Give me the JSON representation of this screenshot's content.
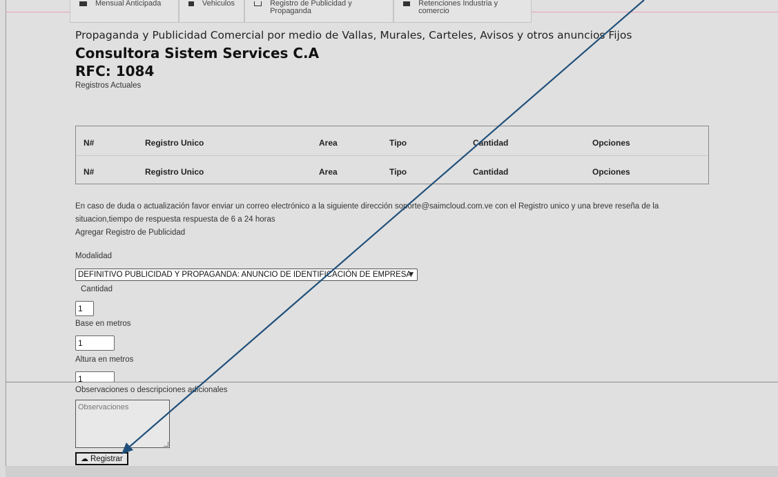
{
  "tabs": [
    {
      "icon": "calendar-icon",
      "label": "Mensual Anticipada"
    },
    {
      "icon": "car-icon",
      "label": "Vehiculos"
    },
    {
      "icon": "billboard-icon",
      "label": "Registro de Publicidad y Propaganda"
    },
    {
      "icon": "building-icon",
      "label": "Retenciones Industria y comercio"
    }
  ],
  "header": {
    "line_title": "Propaganda y Publicidad Comercial por medio de Vallas, Murales, Carteles, Avisos y otros anuncios Fijos",
    "company": "Consultora Sistem Services C.A",
    "rfc": "RFC: 1084",
    "subtitle": "Registros Actuales"
  },
  "table": {
    "columns": [
      "N#",
      "Registro Unico",
      "Area",
      "Tipo",
      "Cantidad",
      "Opciones"
    ],
    "footer_columns": [
      "N#",
      "Registro Unico",
      "Area",
      "Tipo",
      "Cantidad",
      "Opciones"
    ]
  },
  "info": {
    "line1": "En caso de duda o actualización favor enviar un correo electrónico a la siguiente dirección soporte@saimcloud.com.ve con el Registro unico y una breve reseña de la",
    "line2": "situacion,tiempo de respuesta respuesta de 6 a 24 horas",
    "add_title": "Agregar Registro de Publicidad"
  },
  "form": {
    "modalidad_label": "Modalidad",
    "modalidad_value": "DEFINITIVO PUBLICIDAD Y PROPAGANDA: ANUNCIO DE IDENTIFICACIÓN DE EMPRESA",
    "cantidad_label": "Cantidad",
    "cantidad_value": "1",
    "base_label": "Base en metros",
    "base_value": "1",
    "altura_label": "Altura en metros",
    "altura_value": "1",
    "obs_label": "Observaciones o descripciones adicionales",
    "obs_placeholder": "Observaciones",
    "submit_label": "Registrar",
    "submit_icon": "cloud-upload-icon"
  },
  "annotation": {
    "type": "arrow",
    "color": "#1f4f7a"
  }
}
